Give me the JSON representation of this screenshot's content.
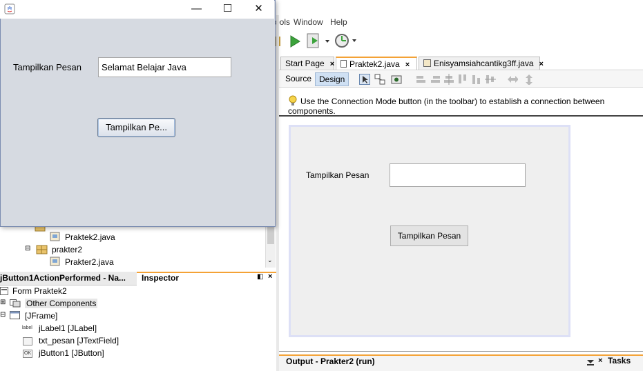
{
  "ide": {
    "menu": [
      "ools",
      "Window",
      "Help"
    ],
    "editor_tabs": [
      {
        "label": "Start Page",
        "close": "×"
      },
      {
        "label": "Praktek2.java",
        "close": "×"
      },
      {
        "label": "Enisyamsiahcantikg3ff.java",
        "close": "×"
      }
    ],
    "design_bar": {
      "source": "Source",
      "design": "Design"
    },
    "hint": "Use the Connection Mode button (in the toolbar) to establish a connection between components.",
    "canvas": {
      "label": "Tampilkan Pesan",
      "button": "Tampilkan Pesan"
    },
    "output_title": "Output - Prakter2 (run)",
    "tasks": "Tasks"
  },
  "projects_tree": {
    "items": [
      {
        "label": "Praktek2.java"
      },
      {
        "label": "prakter2"
      },
      {
        "label": "Prakter2.java"
      }
    ]
  },
  "navigator": {
    "left_tab": "jButton1ActionPerformed - Na...",
    "inspector_tab": "Inspector",
    "items": [
      {
        "label": "Form Praktek2"
      },
      {
        "label": "Other Components"
      },
      {
        "label": "[JFrame]"
      },
      {
        "label": "jLabel1 [JLabel]",
        "icon_text": "label"
      },
      {
        "label": "txt_pesan [JTextField]"
      },
      {
        "label": "jButton1 [JButton]",
        "icon_text": "OK"
      }
    ]
  },
  "app_window": {
    "label": "Tampilkan Pesan",
    "field_value": "Selamat Belajar Java",
    "button": "Tampilkan Pe...",
    "controls": {
      "minimize": "—",
      "maximize": "☐",
      "close": "✕"
    }
  }
}
